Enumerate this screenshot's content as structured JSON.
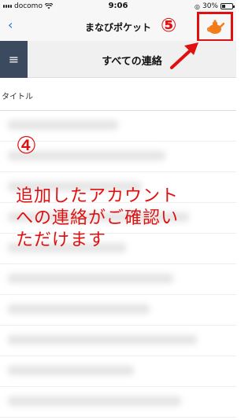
{
  "status_bar": {
    "carrier": "docomo",
    "time": "9:06",
    "battery_text": "30%",
    "battery_level": 0.3
  },
  "header": {
    "back_icon": "chevron-left-icon",
    "title": "まなびポケット",
    "avatar_icon": "teapot-avatar-icon"
  },
  "subheader": {
    "menu_icon": "hamburger-icon",
    "menu_glyph": "≡",
    "title": "すべての連絡"
  },
  "table": {
    "column_title": "タイトル"
  },
  "annotations": {
    "step5": "⑤",
    "step4": "④",
    "line1": "追加したアカウント",
    "line2": "への連絡がご確認い",
    "line3": "ただけます"
  },
  "colors": {
    "annotation": "#e01010",
    "menu_bg": "#3b4a5e",
    "link": "#1a73e8"
  }
}
